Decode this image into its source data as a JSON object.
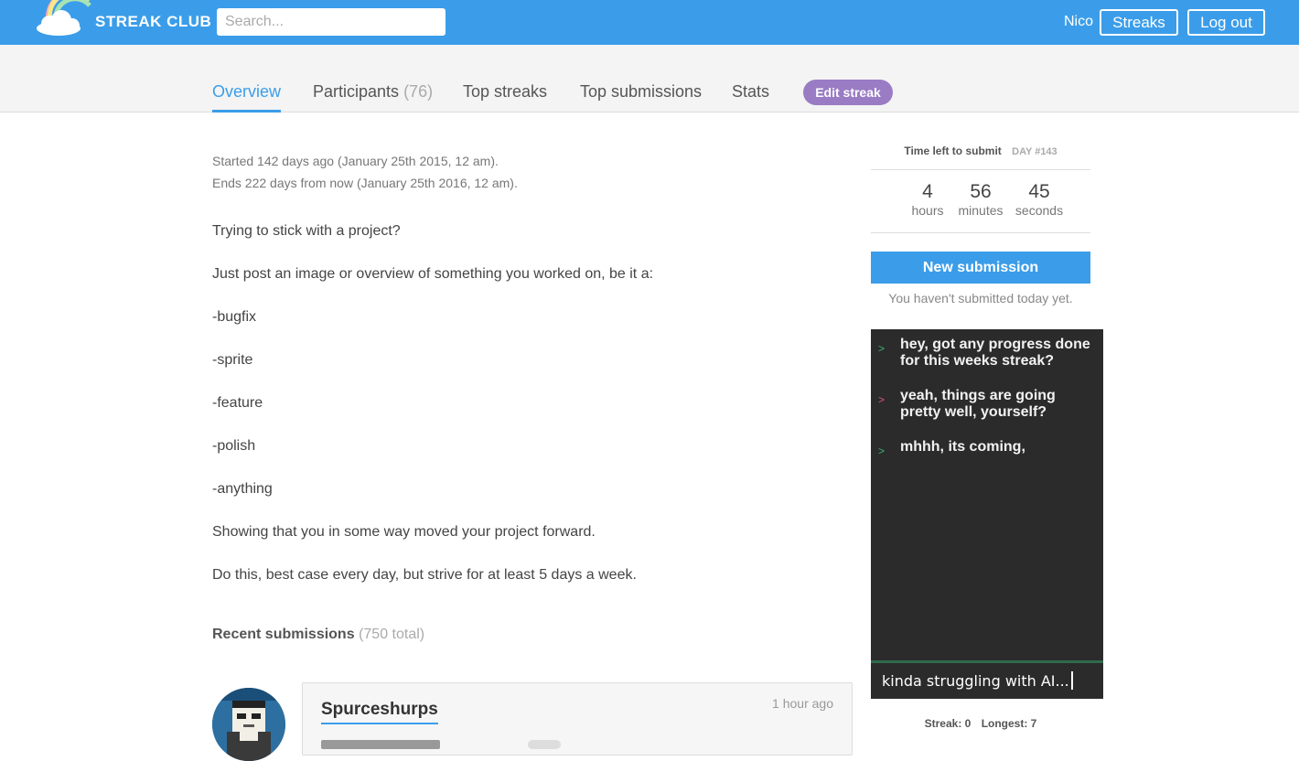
{
  "header": {
    "brand": "STREAK CLUB",
    "search_placeholder": "Search...",
    "user": "Nico",
    "streaks_label": "Streaks",
    "logout_label": "Log out"
  },
  "tabs": {
    "overview": "Overview",
    "participants": "Participants",
    "participants_count": "(76)",
    "top_streaks": "Top streaks",
    "top_submissions": "Top submissions",
    "stats": "Stats",
    "edit_streak": "Edit streak"
  },
  "overview": {
    "started": "Started 142 days ago (January 25th 2015, 12 am).",
    "ends": "Ends 222 days from now (January 25th 2016, 12 am).",
    "description": [
      "Trying to stick with a project?",
      "Just post an image or overview of something you worked on, be it a:",
      "-bugfix",
      "-sprite",
      "-feature",
      "-polish",
      "-anything",
      "Showing that you in some way moved your project forward.",
      "Do this, best case every day, but strive for at least 5 days a week."
    ],
    "recent_label": "Recent submissions",
    "recent_total": "(750 total)"
  },
  "submission": {
    "username": "Spurceshurps",
    "time_ago": "1 hour ago"
  },
  "sidebar": {
    "time_left_label": "Time left to submit",
    "day_label": "DAY #143",
    "hours": "4",
    "hours_label": "hours",
    "minutes": "56",
    "minutes_label": "minutes",
    "seconds": "45",
    "seconds_label": "seconds",
    "new_submission": "New submission",
    "not_submitted": "You haven't submitted today yet.",
    "streak_label": "Streak: 0",
    "longest_label": "Longest: 7"
  },
  "chat": {
    "messages": [
      {
        "prompt": ">",
        "color": "#3cb371",
        "text": "hey, got any progress done for this weeks streak?"
      },
      {
        "prompt": ">",
        "color": "#e0508c",
        "text": "yeah, things are going pretty well, yourself?"
      },
      {
        "prompt": ">",
        "color": "#3cb371",
        "text": "mhhh, its coming,"
      }
    ],
    "input_value": "kinda struggling with AI..."
  },
  "colors": {
    "brand_blue": "#3b9de9",
    "edit_purple": "#9a7cc5",
    "chat_bg": "#2b2b2b"
  }
}
